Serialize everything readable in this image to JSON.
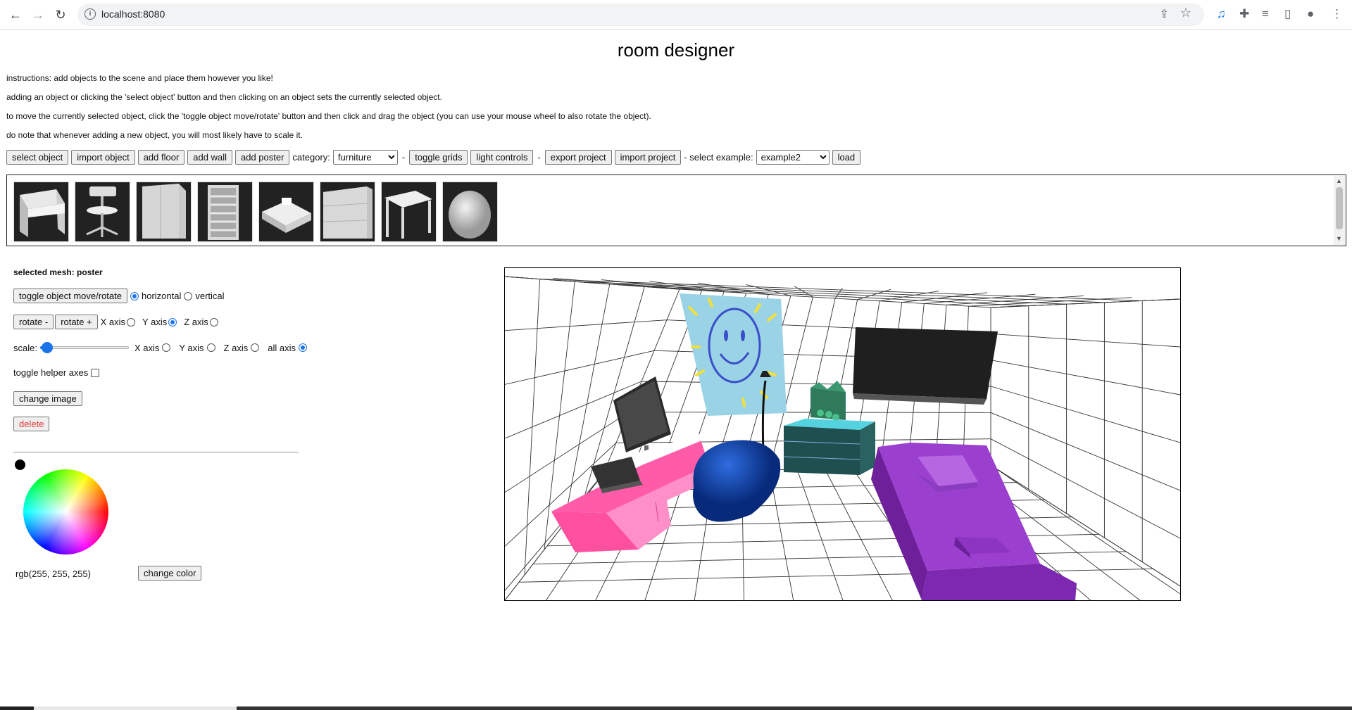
{
  "browser": {
    "url": "localhost:8080",
    "info_icon": "info-icon",
    "icons": [
      "back-arrow-icon",
      "forward-arrow-icon",
      "reload-icon",
      "share-icon",
      "star-icon",
      "extension-icon",
      "puzzle-icon",
      "media-icon",
      "side-panel-icon",
      "profile-icon",
      "menu-icon"
    ]
  },
  "page": {
    "title": "room designer",
    "instructions": [
      "instructions: add objects to the scene and place them however you like!",
      "adding an object or clicking the 'select object' button and then clicking on an object sets the currently selected object.",
      "to move the currently selected object, click the 'toggle object move/rotate' button and then click and drag the object (you can use your mouse wheel to also rotate the object).",
      "do note that whenever adding a new object, you will most likely have to scale it."
    ]
  },
  "toolbar": {
    "select_object": "select object",
    "import_object": "import object",
    "add_floor": "add floor",
    "add_wall": "add wall",
    "add_poster": "add poster",
    "category_label": "category:",
    "category_value": "furniture",
    "dash": "-",
    "toggle_grids": "toggle grids",
    "light_controls": "light controls",
    "export_project": "export project",
    "import_project": "import project",
    "select_example_label": "- select example:",
    "example_value": "example2",
    "load": "load"
  },
  "palette": {
    "items": [
      "desk",
      "office chair",
      "wardrobe",
      "bookshelf",
      "sink counter",
      "dresser",
      "table",
      "bean bag"
    ]
  },
  "panel": {
    "selected_mesh": "selected mesh: poster",
    "toggle_move_rotate": "toggle object move/rotate",
    "horizontal": "horizontal",
    "vertical": "vertical",
    "move_mode": "horizontal",
    "rotate_minus": "rotate -",
    "rotate_plus": "rotate +",
    "x_axis": "X axis",
    "y_axis": "Y axis",
    "z_axis": "Z axis",
    "rotate_axis": "Y",
    "scale_label": "scale:",
    "scale_fraction": 0.08,
    "all_axis": "all axis",
    "scale_axis": "all",
    "toggle_helper_axes": "toggle helper axes",
    "helper_axes_checked": false,
    "change_image": "change image",
    "delete": "delete",
    "rgb_value": "rgb(255, 255, 255)",
    "change_color": "change color"
  },
  "scene": {
    "objects": [
      "grid room",
      "smiley poster",
      "tv",
      "monitor",
      "pink desk",
      "laptop",
      "blue bean bag",
      "floor lamp",
      "teal dresser",
      "green plant",
      "purple bed"
    ]
  },
  "colors": {
    "accent": "#1a73e8",
    "delete": "#e53935",
    "desk": "#ff5ba8",
    "beanbag": "#0a3fb0",
    "bed": "#9b3fcf",
    "dresser": "#1f4f4f",
    "poster": "#9ad3e6"
  }
}
